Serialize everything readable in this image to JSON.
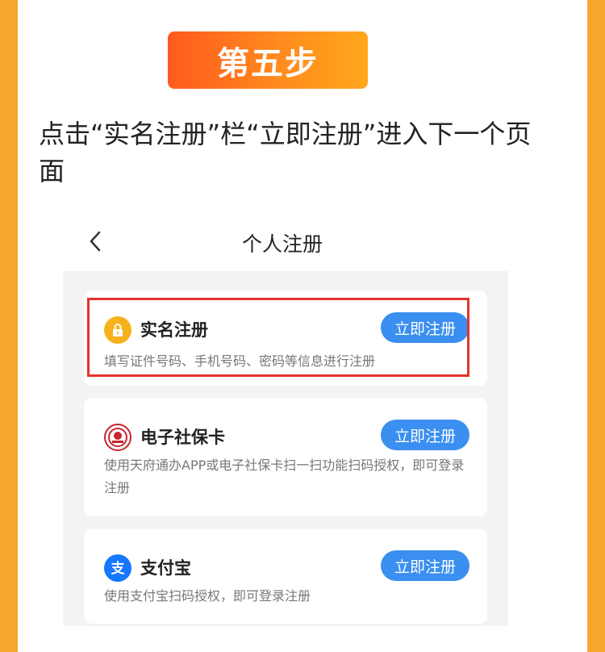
{
  "step_badge": "第五步",
  "instruction": "点击“实名注册”栏“立即注册”进入下一个页面",
  "nav": {
    "back_icon": "chevron-left-icon",
    "title": "个人注册"
  },
  "cards": [
    {
      "icon": "lock-icon",
      "title": "实名注册",
      "description": "填写证件号码、手机号码、密码等信息进行注册",
      "button": "立即注册"
    },
    {
      "icon": "social-security-card-icon",
      "title": "电子社保卡",
      "description": "使用天府通办APP或电子社保卡扫一扫功能扫码授权，即可登录注册",
      "button": "立即注册"
    },
    {
      "icon": "alipay-icon",
      "title": "支付宝",
      "description": "使用支付宝扫码授权，即可登录注册",
      "button": "立即注册"
    }
  ],
  "colors": {
    "accent_orange": "#ff7a1d",
    "button_blue": "#3a8ff0",
    "highlight_red": "#e5322d",
    "border_orange": "#f7a62c"
  }
}
